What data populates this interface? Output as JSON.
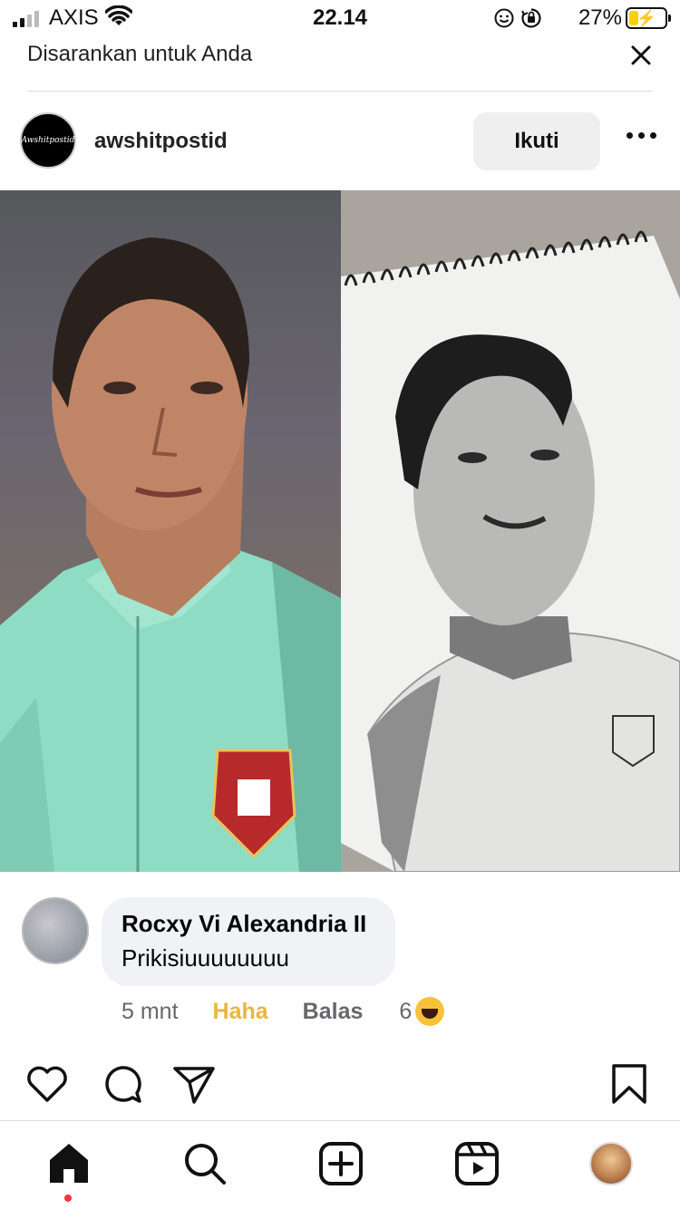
{
  "status_bar": {
    "carrier": "AXIS",
    "time": "22.14",
    "battery_percent": "27%",
    "battery_level": 0.27
  },
  "suggested": {
    "title": "Disarankan untuk Anda"
  },
  "post": {
    "username": "awshitpostid",
    "avatar_logo_text": "Awshitpostid",
    "follow_label": "Ikuti"
  },
  "comment": {
    "author": "Rocxy Vi Alexandria II",
    "text": "Prikisiuuuuuuuu",
    "time": "5 mnt",
    "reaction_label": "Haha",
    "reply_label": "Balas",
    "reaction_count": "6"
  },
  "colors": {
    "haha": "#e9b63e",
    "notification_dot": "#ff3040",
    "battery_fill": "#f5d300"
  },
  "icons": {
    "actions": [
      "heart-icon",
      "comment-icon",
      "share-icon",
      "bookmark-icon"
    ],
    "tabs": [
      "home-icon",
      "search-icon",
      "create-icon",
      "reels-icon",
      "profile-avatar"
    ]
  }
}
